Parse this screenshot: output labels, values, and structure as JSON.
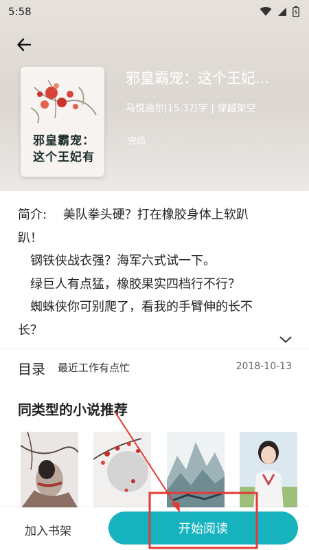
{
  "status_bar": {
    "time": "5:58"
  },
  "book": {
    "title": "邪皇霸宠：这个王妃...",
    "cover_title_line1": "邪皇霸宠：",
    "cover_title_line2": "这个王妃有",
    "meta": "马悦迪尔|15.3万字 | 穿越架空",
    "status": "完结"
  },
  "intro": {
    "lines": [
      "简介:　 美队拳头硬？打在橡胶身体上软趴",
      "趴！",
      "　钢铁侠战衣强？海军六式试一下。",
      "　绿巨人有点猛，橡胶果实四档行不行？",
      "　蜘蛛侠你可别爬了，看我的手臂伸的长不",
      "长？"
    ]
  },
  "toc": {
    "label": "目录",
    "latest": "最近工作有点忙",
    "date": "2018-10-13"
  },
  "recommend": {
    "title": "同类型的小说推荐"
  },
  "bottom": {
    "shelf_label": "加入书架",
    "read_label": "开始阅读"
  },
  "colors": {
    "accent": "#16b3be",
    "annotation": "#e53935"
  },
  "icons": [
    "back-arrow-icon",
    "wifi-icon",
    "signal-icon",
    "battery-icon",
    "chevron-down-icon"
  ]
}
